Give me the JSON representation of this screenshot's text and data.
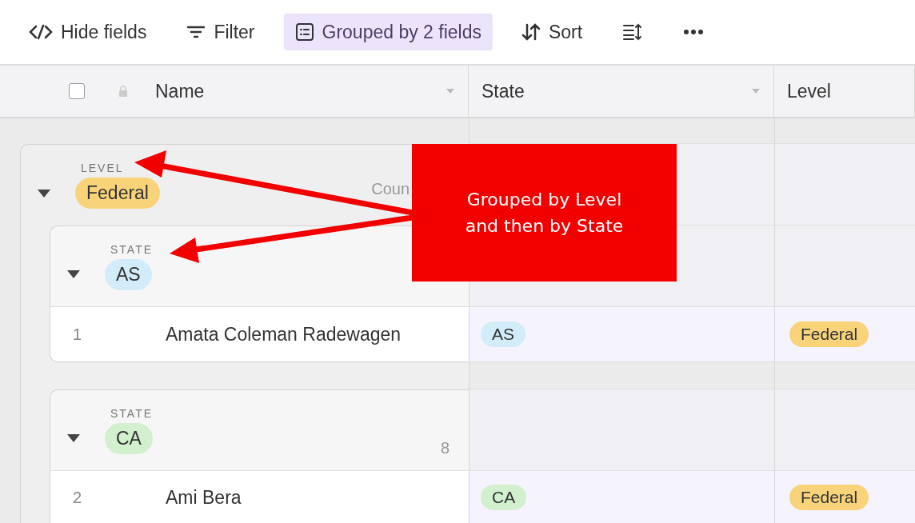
{
  "toolbar": [
    {
      "kind": "hide",
      "label": "Hide fields",
      "selected": false
    },
    {
      "kind": "filter",
      "label": "Filter",
      "selected": false
    },
    {
      "kind": "group",
      "label": "Grouped by 2 fields",
      "selected": true
    },
    {
      "kind": "sort",
      "label": "Sort",
      "selected": false
    },
    {
      "kind": "rowheight",
      "selected": false
    },
    {
      "kind": "more",
      "selected": false
    }
  ],
  "header": {
    "select_all_checked": false,
    "columns": [
      {
        "label": "Name",
        "has_menu": true,
        "locked": true
      },
      {
        "label": "State",
        "has_menu": true,
        "locked": false
      },
      {
        "label": "Level",
        "has_menu": false,
        "locked": false
      }
    ]
  },
  "groups": [
    {
      "field": "LEVEL",
      "value": "Federal",
      "color": "#f8d37a",
      "count_label": "Coun",
      "expanded": true,
      "children": [
        {
          "field": "STATE",
          "value": "AS",
          "color": "#d3ecf9",
          "expanded": true,
          "records": [
            {
              "number": "1",
              "name": "Amata Coleman Radewagen",
              "state": {
                "value": "AS",
                "color": "#d3ecf9"
              },
              "level": {
                "value": "Federal",
                "color": "#f8d37a"
              }
            }
          ]
        },
        {
          "field": "STATE",
          "value": "CA",
          "color": "#d2f0ce",
          "count": "8",
          "expanded": true,
          "records": [
            {
              "number": "2",
              "name": "Ami Bera",
              "state": {
                "value": "CA",
                "color": "#d2f0ce"
              },
              "level": {
                "value": "Federal",
                "color": "#f8d37a"
              }
            }
          ]
        }
      ]
    }
  ],
  "callout": {
    "text": "Grouped by Level and then by State"
  }
}
